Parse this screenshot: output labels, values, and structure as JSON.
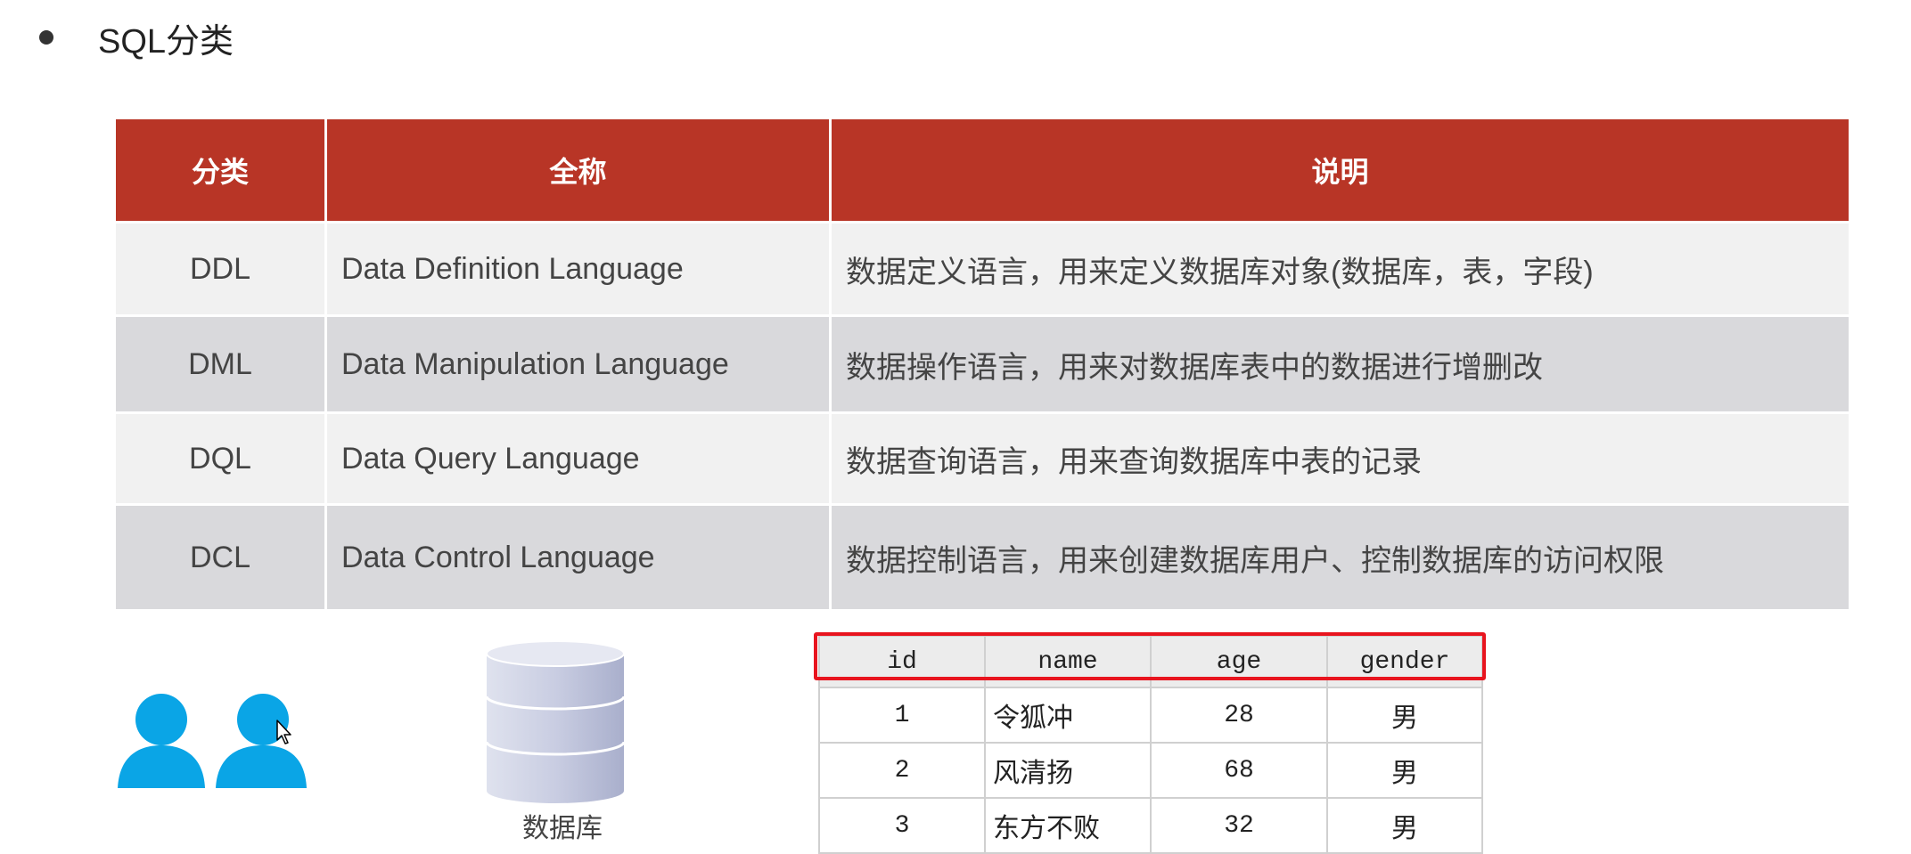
{
  "heading": "SQL分类",
  "sql_table": {
    "headers": [
      "分类",
      "全称",
      "说明"
    ],
    "rows": [
      {
        "category": "DDL",
        "full_name": "Data Definition Language",
        "description": "数据定义语言，用来定义数据库对象(数据库，表，字段)"
      },
      {
        "category": "DML",
        "full_name": "Data Manipulation Language",
        "description": "数据操作语言，用来对数据库表中的数据进行增删改"
      },
      {
        "category": "DQL",
        "full_name": "Data Query Language",
        "description": "数据查询语言，用来查询数据库中表的记录"
      },
      {
        "category": "DCL",
        "full_name": "Data Control Language",
        "description": "数据控制语言，用来创建数据库用户、控制数据库的访问权限"
      }
    ]
  },
  "database_label": "数据库",
  "data_table": {
    "headers": [
      "id",
      "name",
      "age",
      "gender"
    ],
    "rows": [
      [
        "1",
        "令狐冲",
        "28",
        "男"
      ],
      [
        "2",
        "风清扬",
        "68",
        "男"
      ],
      [
        "3",
        "东方不败",
        "32",
        "男"
      ]
    ]
  },
  "colors": {
    "header_red": "#b83526",
    "row_light": "#f1f1f1",
    "row_dark": "#d9d9dc",
    "user_icon_blue": "#0aa5e6",
    "highlight_red": "#e8141e"
  },
  "icons": [
    "bullet-dot",
    "user-icon",
    "database-icon",
    "mouse-cursor-icon"
  ]
}
